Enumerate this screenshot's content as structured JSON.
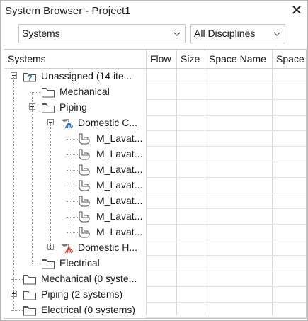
{
  "window": {
    "title": "System Browser - Project1",
    "close_icon": "close-icon"
  },
  "filters": {
    "view": "Systems",
    "discipline": "All Disciplines"
  },
  "columns": [
    "Systems",
    "Flow",
    "Size",
    "Space Name",
    "Space"
  ],
  "tree": [
    {
      "label": "Unassigned (14 ite...",
      "icon": "unknown-system-icon",
      "expander": "minus"
    },
    {
      "label": "Mechanical",
      "icon": "folder-icon",
      "expander": "none"
    },
    {
      "label": "Piping",
      "icon": "folder-icon",
      "expander": "minus"
    },
    {
      "label": "Domestic C...",
      "icon": "domestic-cold-water-icon",
      "expander": "minus"
    },
    {
      "label": "M_Lavat...",
      "icon": "lavatory-icon",
      "expander": "none"
    },
    {
      "label": "M_Lavat...",
      "icon": "lavatory-icon",
      "expander": "none"
    },
    {
      "label": "M_Lavat...",
      "icon": "lavatory-icon",
      "expander": "none"
    },
    {
      "label": "M_Lavat...",
      "icon": "lavatory-icon",
      "expander": "none"
    },
    {
      "label": "M_Lavat...",
      "icon": "lavatory-icon",
      "expander": "none"
    },
    {
      "label": "M_Lavat...",
      "icon": "lavatory-icon",
      "expander": "none"
    },
    {
      "label": "M_Lavat...",
      "icon": "lavatory-icon",
      "expander": "none"
    },
    {
      "label": "Domestic H...",
      "icon": "domestic-hot-water-icon",
      "expander": "plus"
    },
    {
      "label": "Electrical",
      "icon": "folder-icon",
      "expander": "none"
    },
    {
      "label": "Mechanical (0 syste...",
      "icon": "folder-icon",
      "expander": "none"
    },
    {
      "label": "Piping (2 systems)",
      "icon": "folder-icon",
      "expander": "plus"
    },
    {
      "label": "Electrical (0 systems)",
      "icon": "folder-icon",
      "expander": "none"
    }
  ],
  "colors": {
    "border": "#c7c7c7",
    "gridline": "#d8d8d8",
    "cold_water": "#1e6fc0",
    "hot_water": "#d0352b",
    "unknown_system": "#2a7bd0"
  }
}
